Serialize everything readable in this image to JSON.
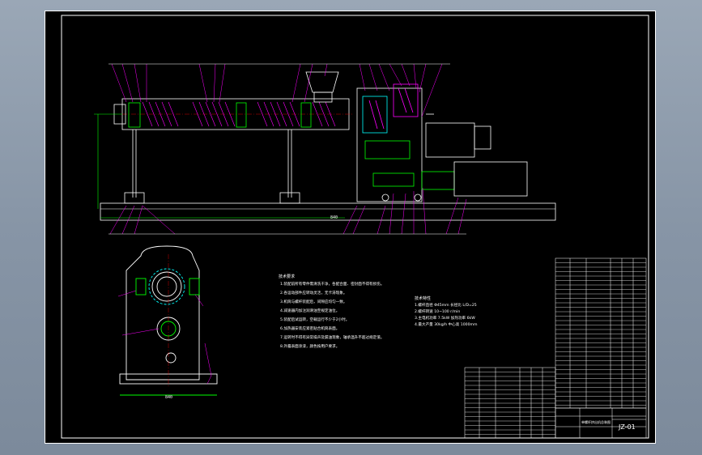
{
  "drawing": {
    "notes_left": {
      "title": "技术要求",
      "lines": [
        "1.装配前所有零件需清洗干净，各配合面、密封面不得有损伤。",
        "2.各运动部件应转动灵活，无卡滞现象。",
        "3.机筒与螺杆装配后，间隙应均匀一致。",
        "4.减速器内加注润滑油至规定油位。",
        "5.装配后试运转，空载运行不少于2小时。",
        "6.加热器安装应紧密贴合机筒表面。",
        "7.运转时不得有异常噪声及漏油现象，轴承温升不超过规定值。",
        "8.外露表面涂漆，颜色按用户要求。"
      ]
    },
    "notes_right": {
      "title": "技术特性",
      "lines": [
        "1.螺杆直径 Φ45mm  长径比 L/D=25",
        "2.螺杆转速 10~100 r/min",
        "3.主电机功率 7.5kW  加热功率 6kW",
        "4.最大产量 30kg/h  中心高 1000mm"
      ]
    },
    "dimension_label": "840",
    "drawing_number": "JZ-01",
    "title_block_label": "单螺杆挤出机总装图",
    "colors": {
      "green": "#00ff00",
      "magenta": "#ff00ff",
      "cyan": "#00ffff",
      "white": "#ffffff",
      "yellow": "#ffff00"
    }
  }
}
